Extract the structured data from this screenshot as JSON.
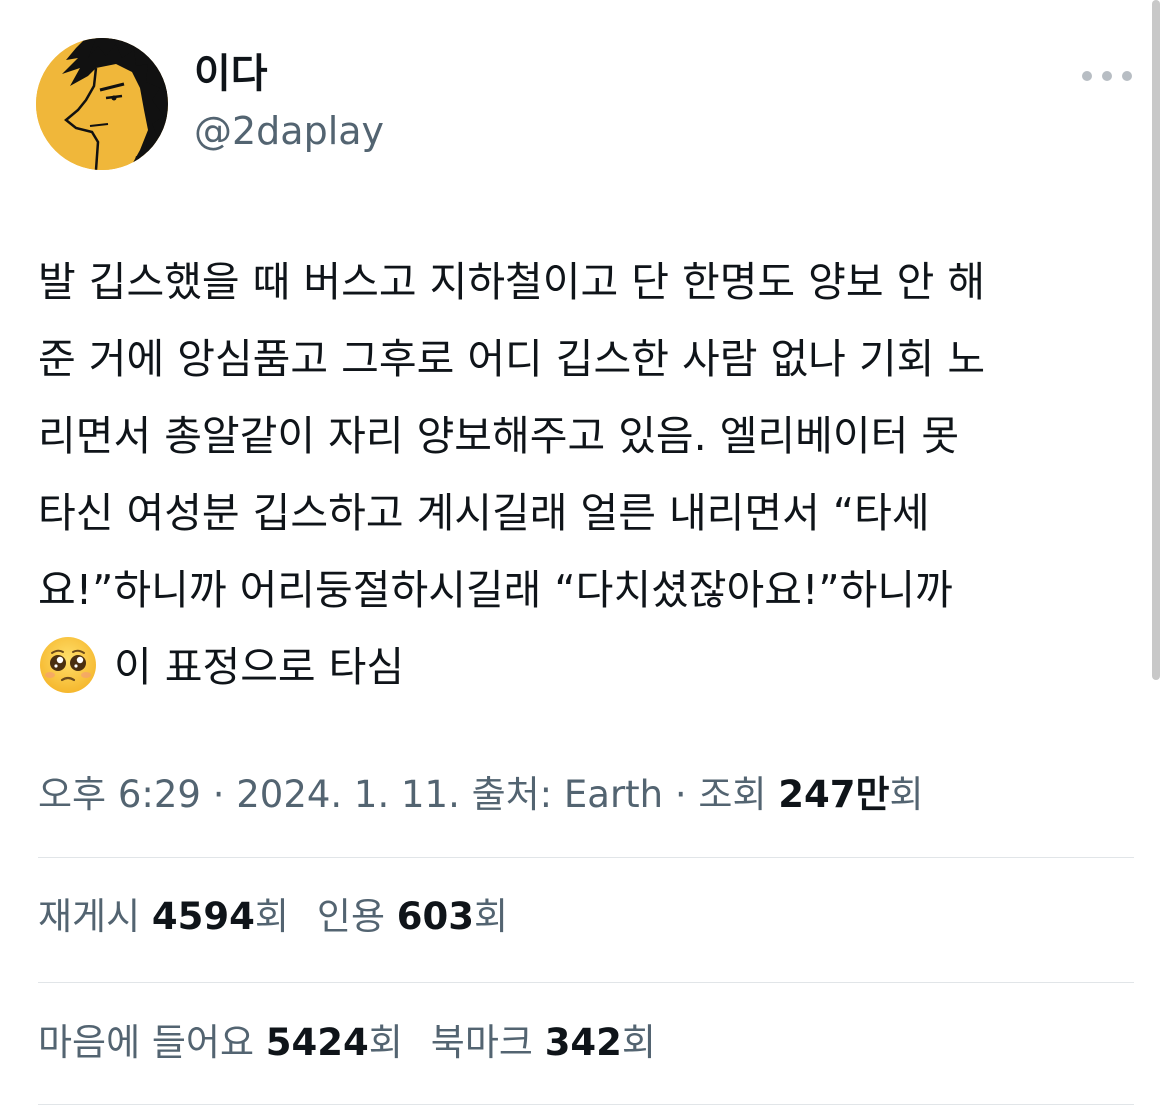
{
  "author": {
    "display_name": "이다",
    "handle": "@2daplay"
  },
  "tweet": {
    "lines": [
      "발 깁스했을 때 버스고 지하철이고 단 한명도 양보 안 해",
      "준 거에 앙심품고 그후로 어디 깁스한 사람 없나 기회 노",
      "리면서 총알같이 자리 양보해주고 있음. 엘리베이터 못",
      "타신 여성분 깁스하고 계시길래 얼른 내리면서 “타세",
      "요!”하니까 어리둥절하시길래 “다치셨잖아요!”하니까"
    ],
    "last_line": "이 표정으로 타심",
    "emoji": "pleading-face"
  },
  "meta": {
    "time": "오후 6:29",
    "separator": " · ",
    "date": "2024. 1. 11.",
    "source": "출처: Earth",
    "views_label": "조회 ",
    "views_value": "247만",
    "views_suffix": "회"
  },
  "stats": {
    "retweets_label": "재게시 ",
    "retweets_value": "4594",
    "retweets_suffix": "회",
    "quotes_label": "인용 ",
    "quotes_value": "603",
    "quotes_suffix": "회",
    "likes_label": "마음에 들어요 ",
    "likes_value": "5424",
    "likes_suffix": "회",
    "bookmarks_label": "북마크 ",
    "bookmarks_value": "342",
    "bookmarks_suffix": "회"
  },
  "colors": {
    "text_primary": "#0f1419",
    "text_secondary": "#536471",
    "divider": "#e1e5e8",
    "avatar_bg": "#f0b73a"
  }
}
